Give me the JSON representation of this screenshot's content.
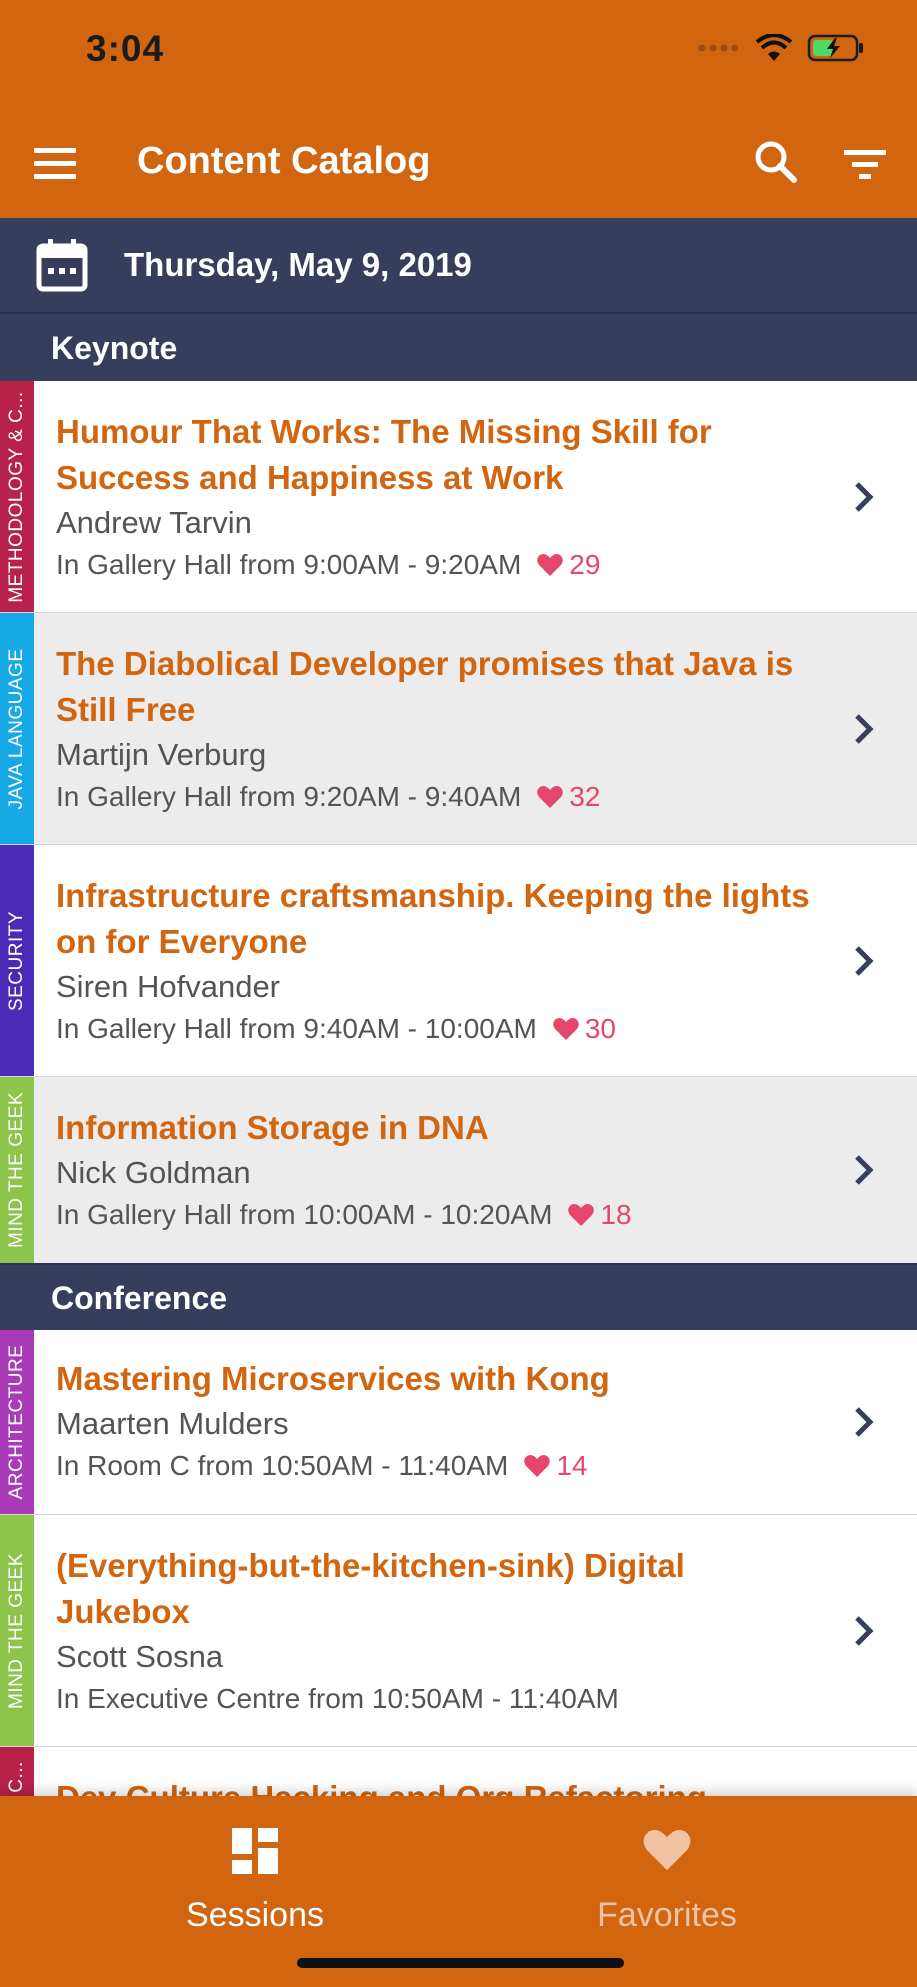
{
  "status_bar": {
    "time": "3:04"
  },
  "app_bar": {
    "title": "Content Catalog"
  },
  "date_bar": {
    "date": "Thursday, May 9, 2019"
  },
  "sections": [
    {
      "title": "Keynote"
    },
    {
      "title": "Conference"
    }
  ],
  "sessions": [
    {
      "track": "METHODOLOGY & C...",
      "track_color": "#B8224A",
      "title_lines": [
        "Humour That Works: The Missing Skill for",
        "Success and Happiness at Work"
      ],
      "speaker": "Andrew Tarvin",
      "meta": "In Gallery Hall from 9:00AM - 9:20AM",
      "likes": "29"
    },
    {
      "track": "JAVA LANGUAGE",
      "track_color": "#17A9E6",
      "title_lines": [
        "The Diabolical Developer promises that Java is",
        "Still Free"
      ],
      "speaker": "Martijn Verburg",
      "meta": "In Gallery Hall from 9:20AM - 9:40AM",
      "likes": "32"
    },
    {
      "track": "SECURITY",
      "track_color": "#4A2BB7",
      "title_lines": [
        "Infrastructure craftsmanship. Keeping the lights",
        "on for Everyone"
      ],
      "speaker": "Siren Hofvander",
      "meta": "In Gallery Hall from 9:40AM - 10:00AM",
      "likes": "30"
    },
    {
      "track": "MIND THE GEEK",
      "track_color": "#8CC54B",
      "title_lines": [
        "Information Storage in DNA"
      ],
      "speaker": "Nick Goldman",
      "meta": "In Gallery Hall from 10:00AM - 10:20AM",
      "likes": "18"
    },
    {
      "track": "ARCHITECTURE",
      "track_color": "#A93BB8",
      "title_lines": [
        "Mastering Microservices with Kong"
      ],
      "speaker": "Maarten Mulders",
      "meta": "In Room C from 10:50AM - 11:40AM",
      "likes": "14"
    },
    {
      "track": "MIND THE GEEK",
      "track_color": "#8CC54B",
      "title_lines": [
        "(Everything-but-the-kitchen-sink) Digital",
        "Jukebox"
      ],
      "speaker": "Scott Sosna",
      "meta": "In Executive Centre from 10:50AM - 11:40AM",
      "likes": ""
    },
    {
      "track": "C...",
      "track_color": "#B8224A",
      "title_lines": [
        "Dev Culture Hacking and Org Refactoring"
      ],
      "speaker": "",
      "meta": "",
      "likes": ""
    }
  ],
  "tabs": [
    {
      "label": "Sessions",
      "icon": "dashboard-icon",
      "active": true
    },
    {
      "label": "Favorites",
      "icon": "heart-icon",
      "active": false
    }
  ],
  "colors": {
    "accent": "#D2650F",
    "header_navy": "#373E5B",
    "like_pink": "#E5466B"
  }
}
